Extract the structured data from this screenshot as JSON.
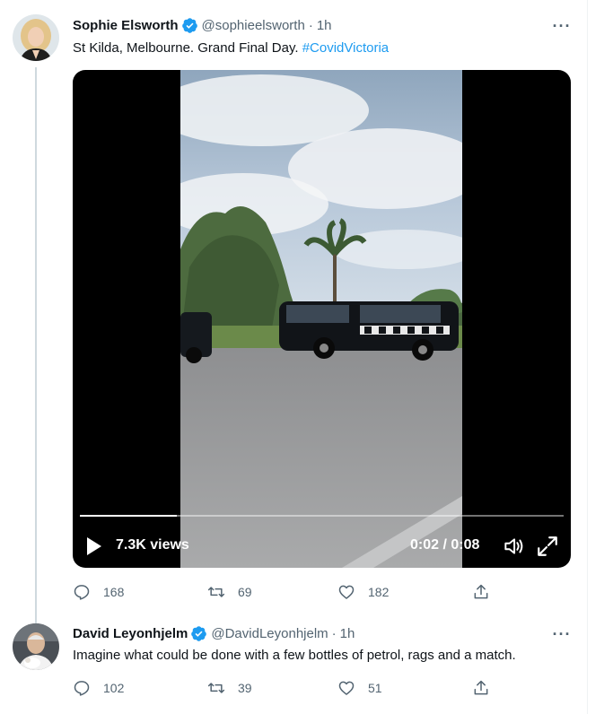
{
  "tweets": [
    {
      "author": "Sophie Elsworth",
      "handle": "@sophieelsworth",
      "separator": "·",
      "time": "1h",
      "more": "···",
      "text": "St Kilda, Melbourne. Grand Final Day. ",
      "hashtag": "#CovidVictoria",
      "video": {
        "views": "7.3K views",
        "duration": "0:02 / 0:08",
        "progress": 0.2
      },
      "stats": {
        "replies": "168",
        "retweets": "69",
        "likes": "182"
      }
    },
    {
      "author": "David Leyonhjelm",
      "handle": "@DavidLeyonhjelm",
      "separator": "·",
      "time": "1h",
      "more": "···",
      "text": "Imagine what could be done with a few bottles of petrol, rags and a match.",
      "stats": {
        "replies": "102",
        "retweets": "39",
        "likes": "51"
      }
    }
  ],
  "icons": [
    "verified-badge-icon",
    "more-icon",
    "play-icon",
    "volume-icon",
    "fullscreen-icon",
    "reply-icon",
    "retweet-icon",
    "like-icon",
    "share-icon"
  ],
  "colors": {
    "accent": "#1d9bf0",
    "text": "#0f1419",
    "secondary": "#536471",
    "thread_line": "#cfd9de"
  }
}
